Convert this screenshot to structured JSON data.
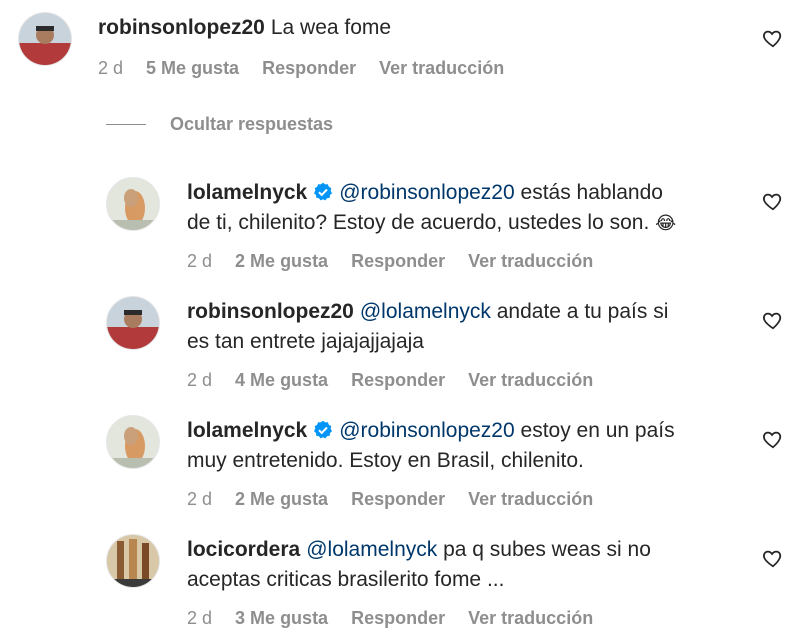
{
  "comments": [
    {
      "username": "robinsonlopez20",
      "mention": "",
      "text": "La wea fome",
      "line2": "",
      "time": "2 d",
      "likes": "5 Me gusta",
      "reply": "Responder",
      "translate": "Ver traducción"
    },
    {
      "username": "lolamelnyck",
      "mention": "@robinsonlopez20",
      "text": "estás hablando",
      "line2": "de ti, chilenito? Estoy de acuerdo, ustedes lo son.",
      "emoji": "😂",
      "time": "2 d",
      "likes": "2 Me gusta",
      "reply": "Responder",
      "translate": "Ver traducción"
    },
    {
      "username": "robinsonlopez20",
      "mention": "@lolamelnyck",
      "text": "andate a tu país si",
      "line2": "es tan entrete jajajajjajaja",
      "time": "2 d",
      "likes": "4 Me gusta",
      "reply": "Responder",
      "translate": "Ver traducción"
    },
    {
      "username": "lolamelnyck",
      "mention": "@robinsonlopez20",
      "text": "estoy en un país",
      "line2": "muy entretenido. Estoy en Brasil, chilenito.",
      "time": "2 d",
      "likes": "2 Me gusta",
      "reply": "Responder",
      "translate": "Ver traducción"
    },
    {
      "username": "locicordera",
      "mention": "@lolamelnyck",
      "text": "pa q subes weas si no",
      "line2": "aceptas criticas brasilerito fome ...",
      "time": "2 d",
      "likes": "3 Me gusta",
      "reply": "Responder",
      "translate": "Ver traducción"
    }
  ],
  "hide_replies": "Ocultar respuestas",
  "colors": {
    "mention": "#00376b",
    "meta": "#8e8e8e",
    "verified": "#0095f6"
  }
}
